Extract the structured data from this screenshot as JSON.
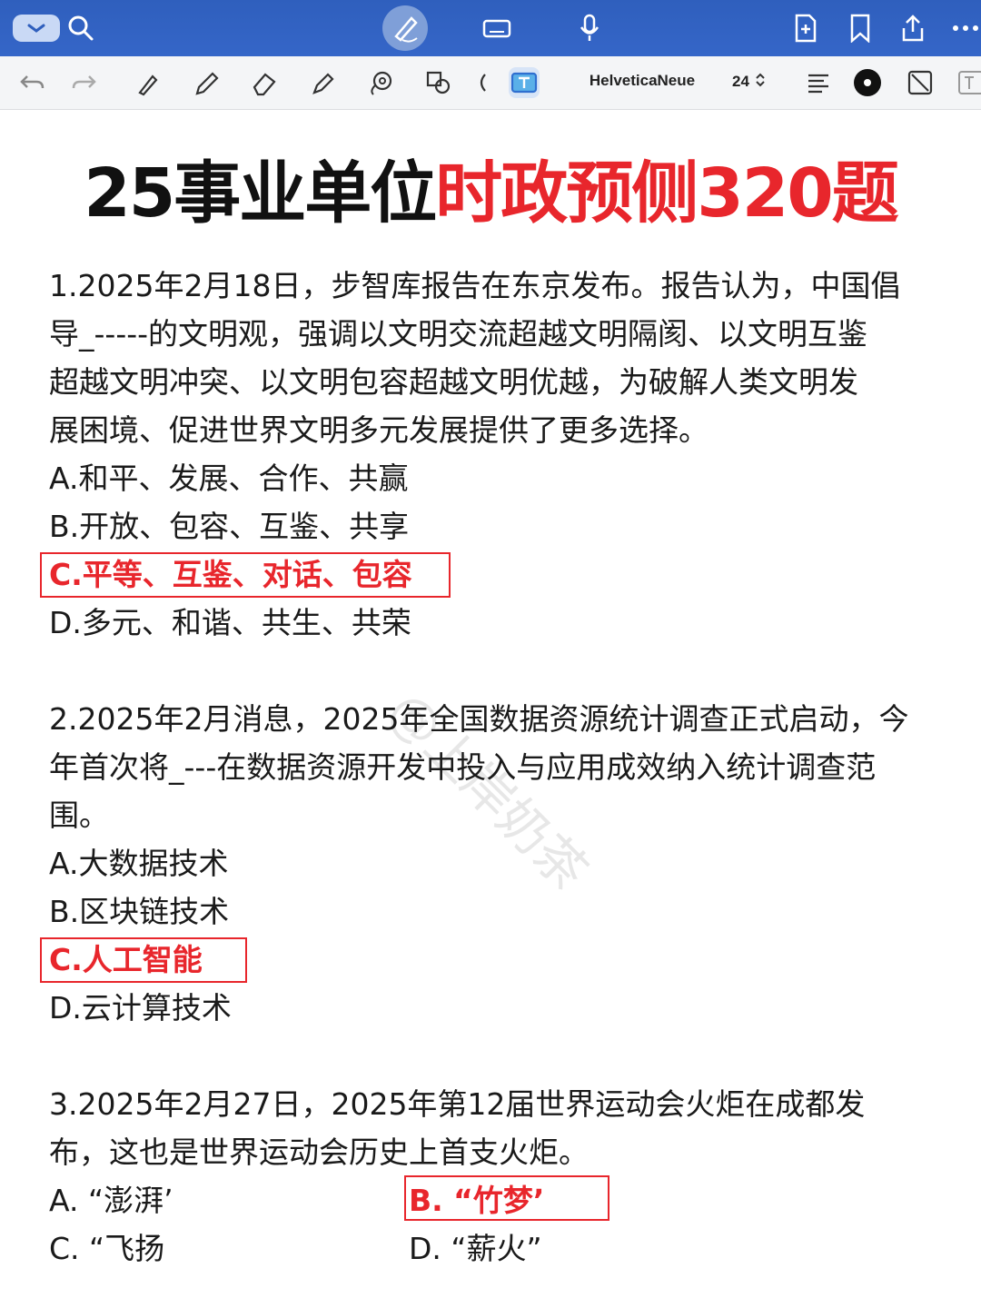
{
  "toolbar": {
    "font_name": "HelveticaNeue",
    "font_size": "24"
  },
  "title": {
    "part1": "25事业单位",
    "part2": "时政预侧320题"
  },
  "questions": [
    {
      "lines": [
        "1.2025年2月18日，步智库报告在东京发布。报告认为，中国倡",
        "导_-----的文明观，强调以文明交流超越文明隔阂、以文明互鉴",
        "超越文明冲突、以文明包容超越文明优越，为破解人类文明发",
        "展困境、促进世界文明多元发展提供了更多选择。"
      ],
      "options": [
        "A.和平、发展、合作、共赢",
        "B.开放、包容、互鉴、共享",
        "C.平等、互鉴、对话、包容",
        "D.多元、和谐、共生、共荣"
      ],
      "answer_index": 2
    },
    {
      "lines": [
        "2.2025年2月消息，2025年全国数据资源统计调查正式启动，今",
        "年首次将_---在数据资源开发中投入与应用成效纳入统计调查范",
        "围。"
      ],
      "options": [
        "A.大数据技术",
        "B.区块链技术",
        "C.人工智能",
        "D.云计算技术"
      ],
      "answer_index": 2
    },
    {
      "lines": [
        "3.2025年2月27日，2025年第12届世界运动会火炬在成都发",
        "布，这也是世界运动会历史上首支火炬。"
      ],
      "options": [
        "A. “澎湃’",
        "B. “竹梦’",
        "C. “飞扬",
        "D. “薪火”"
      ],
      "answer_index": 1
    }
  ],
  "watermark": "@上岸奶茶",
  "colors": {
    "accent_red": "#e8262c",
    "topbar_blue": "#3566c8"
  }
}
